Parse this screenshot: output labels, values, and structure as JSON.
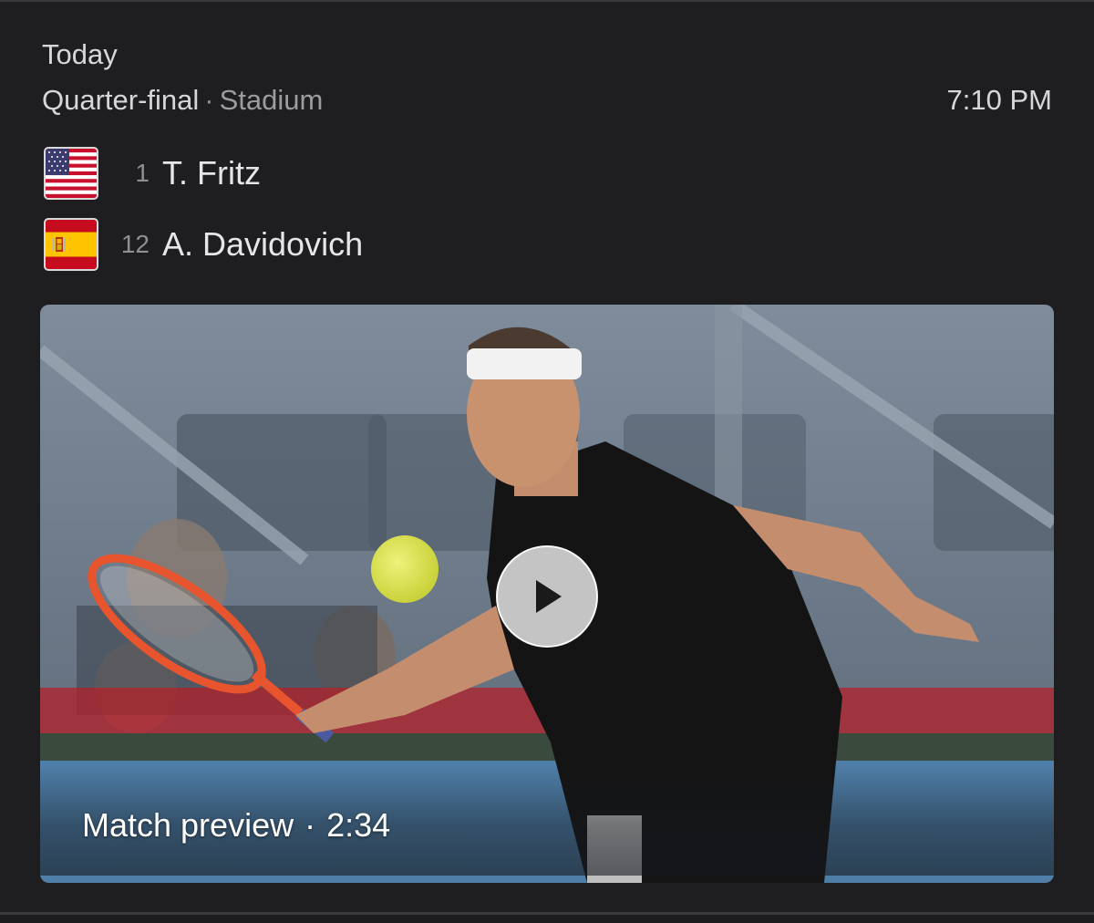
{
  "header": {
    "date": "Today",
    "round": "Quarter-final",
    "separator": "·",
    "venue": "Stadium",
    "time": "7:10 PM"
  },
  "players": [
    {
      "flag_icon": "usa-flag-icon",
      "seed": "1",
      "name": "T. Fritz"
    },
    {
      "flag_icon": "spain-flag-icon",
      "seed": "12",
      "name": "A. Davidovich"
    }
  ],
  "media": {
    "title": "Match preview",
    "separator": "·",
    "duration": "2:34",
    "play_icon": "play-icon"
  },
  "colors": {
    "background": "#1e1e20",
    "primary_text": "#e6e6e8",
    "secondary_text": "#9b9ba0"
  }
}
